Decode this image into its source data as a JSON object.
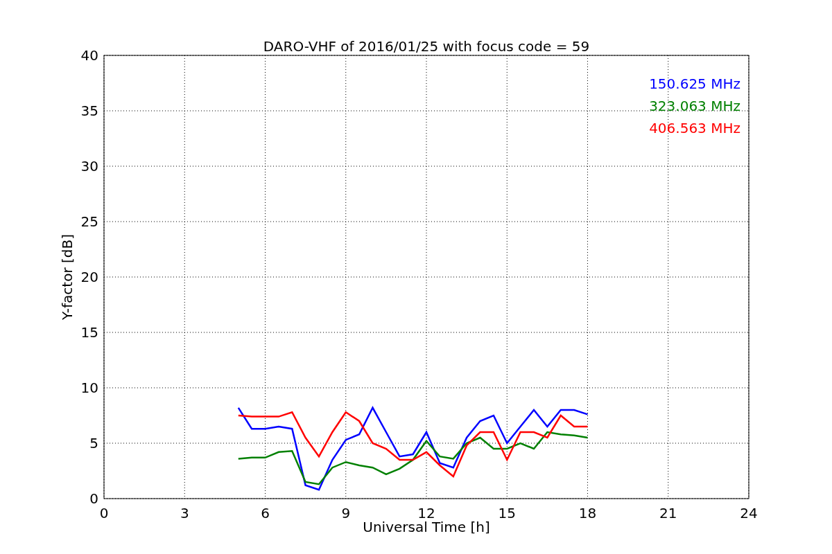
{
  "chart_data": {
    "type": "line",
    "title": "DARO-VHF of 2016/01/25 with focus code = 59",
    "xlabel": "Universal Time [h]",
    "ylabel": "Y-factor [dB]",
    "x": [
      5,
      5.5,
      6,
      6.5,
      7,
      7.5,
      8,
      8.5,
      9,
      9.5,
      10,
      10.5,
      11,
      11.5,
      12,
      12.5,
      13,
      13.5,
      14,
      14.5,
      15,
      15.5,
      16,
      16.5,
      17,
      17.5,
      18
    ],
    "series": [
      {
        "name": "150.625 MHz",
        "color": "#0000ff",
        "values": [
          8.2,
          6.3,
          6.3,
          6.5,
          6.3,
          1.2,
          0.8,
          3.5,
          5.3,
          5.8,
          8.2,
          6,
          3.8,
          4,
          6,
          3.2,
          2.8,
          5.5,
          7,
          7.5,
          5,
          6.5,
          8,
          6.5,
          8,
          8,
          7.6
        ]
      },
      {
        "name": "323.063 MHz",
        "color": "#008000",
        "values": [
          3.6,
          3.7,
          3.7,
          4.2,
          4.3,
          1.5,
          1.3,
          2.8,
          3.3,
          3,
          2.8,
          2.2,
          2.7,
          3.5,
          5.2,
          3.8,
          3.6,
          5,
          5.5,
          4.5,
          4.5,
          5,
          4.5,
          6,
          5.8,
          5.7,
          5.5
        ]
      },
      {
        "name": "406.563 MHz",
        "color": "#ff0000",
        "values": [
          7.5,
          7.4,
          7.4,
          7.4,
          7.8,
          5.5,
          3.8,
          6,
          7.8,
          7,
          5,
          4.5,
          3.5,
          3.5,
          4.2,
          3,
          2,
          4.8,
          6,
          6,
          3.5,
          6,
          6,
          5.5,
          7.5,
          6.5,
          6.5
        ]
      }
    ],
    "grid": true,
    "xlim": [
      0,
      24
    ],
    "ylim": [
      0,
      40
    ],
    "xticks": [
      0,
      3,
      6,
      9,
      12,
      15,
      18,
      21,
      24
    ],
    "yticks": [
      0,
      5,
      10,
      15,
      20,
      25,
      30,
      35,
      40
    ]
  }
}
